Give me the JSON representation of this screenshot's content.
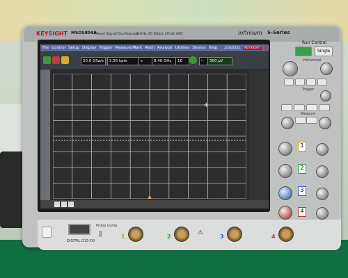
{
  "header": {
    "brand": "KEYSIGHT",
    "model": "MSOS804A",
    "model_desc": "Mixed Signal Oscilloscope",
    "specs": "8 GHz   20 GSa/s   10-bit ADC",
    "series_name": "infiniium",
    "series_suffix": "S-Series"
  },
  "menu": {
    "items": [
      "File",
      "Control",
      "Setup",
      "Display",
      "Trigger",
      "Measure/Mark",
      "Math",
      "Analyze",
      "Utilities",
      "Demos",
      "Help"
    ],
    "date": "2/10/2022",
    "right_badge": "KEYSIGHT"
  },
  "toolbar": {
    "sample_rate": "20.0 GSa/s",
    "memory_depth": "5.55 kpts",
    "bandwidth": "8.40 GHz",
    "averages": "16",
    "trigger_level": "300 µV"
  },
  "panel": {
    "run_control": "Run Control",
    "single": "Single",
    "horizontal": "Horizontal",
    "trigger": "Trigger",
    "measure": "Measure",
    "channels": [
      "1",
      "2",
      "3",
      "4"
    ]
  },
  "bottom": {
    "label_left": "DIGITAL D15-D0",
    "label_probe": "Probe Comp",
    "ch_numbers": [
      "1",
      "2",
      "3",
      "4"
    ]
  },
  "colors": {
    "menu_bar": "#5a6aa0",
    "grid_line": "#bfbfbf",
    "trace": "#e6e6e6",
    "trigger_marker": "#f0a030",
    "brand_red": "#c0141a"
  }
}
